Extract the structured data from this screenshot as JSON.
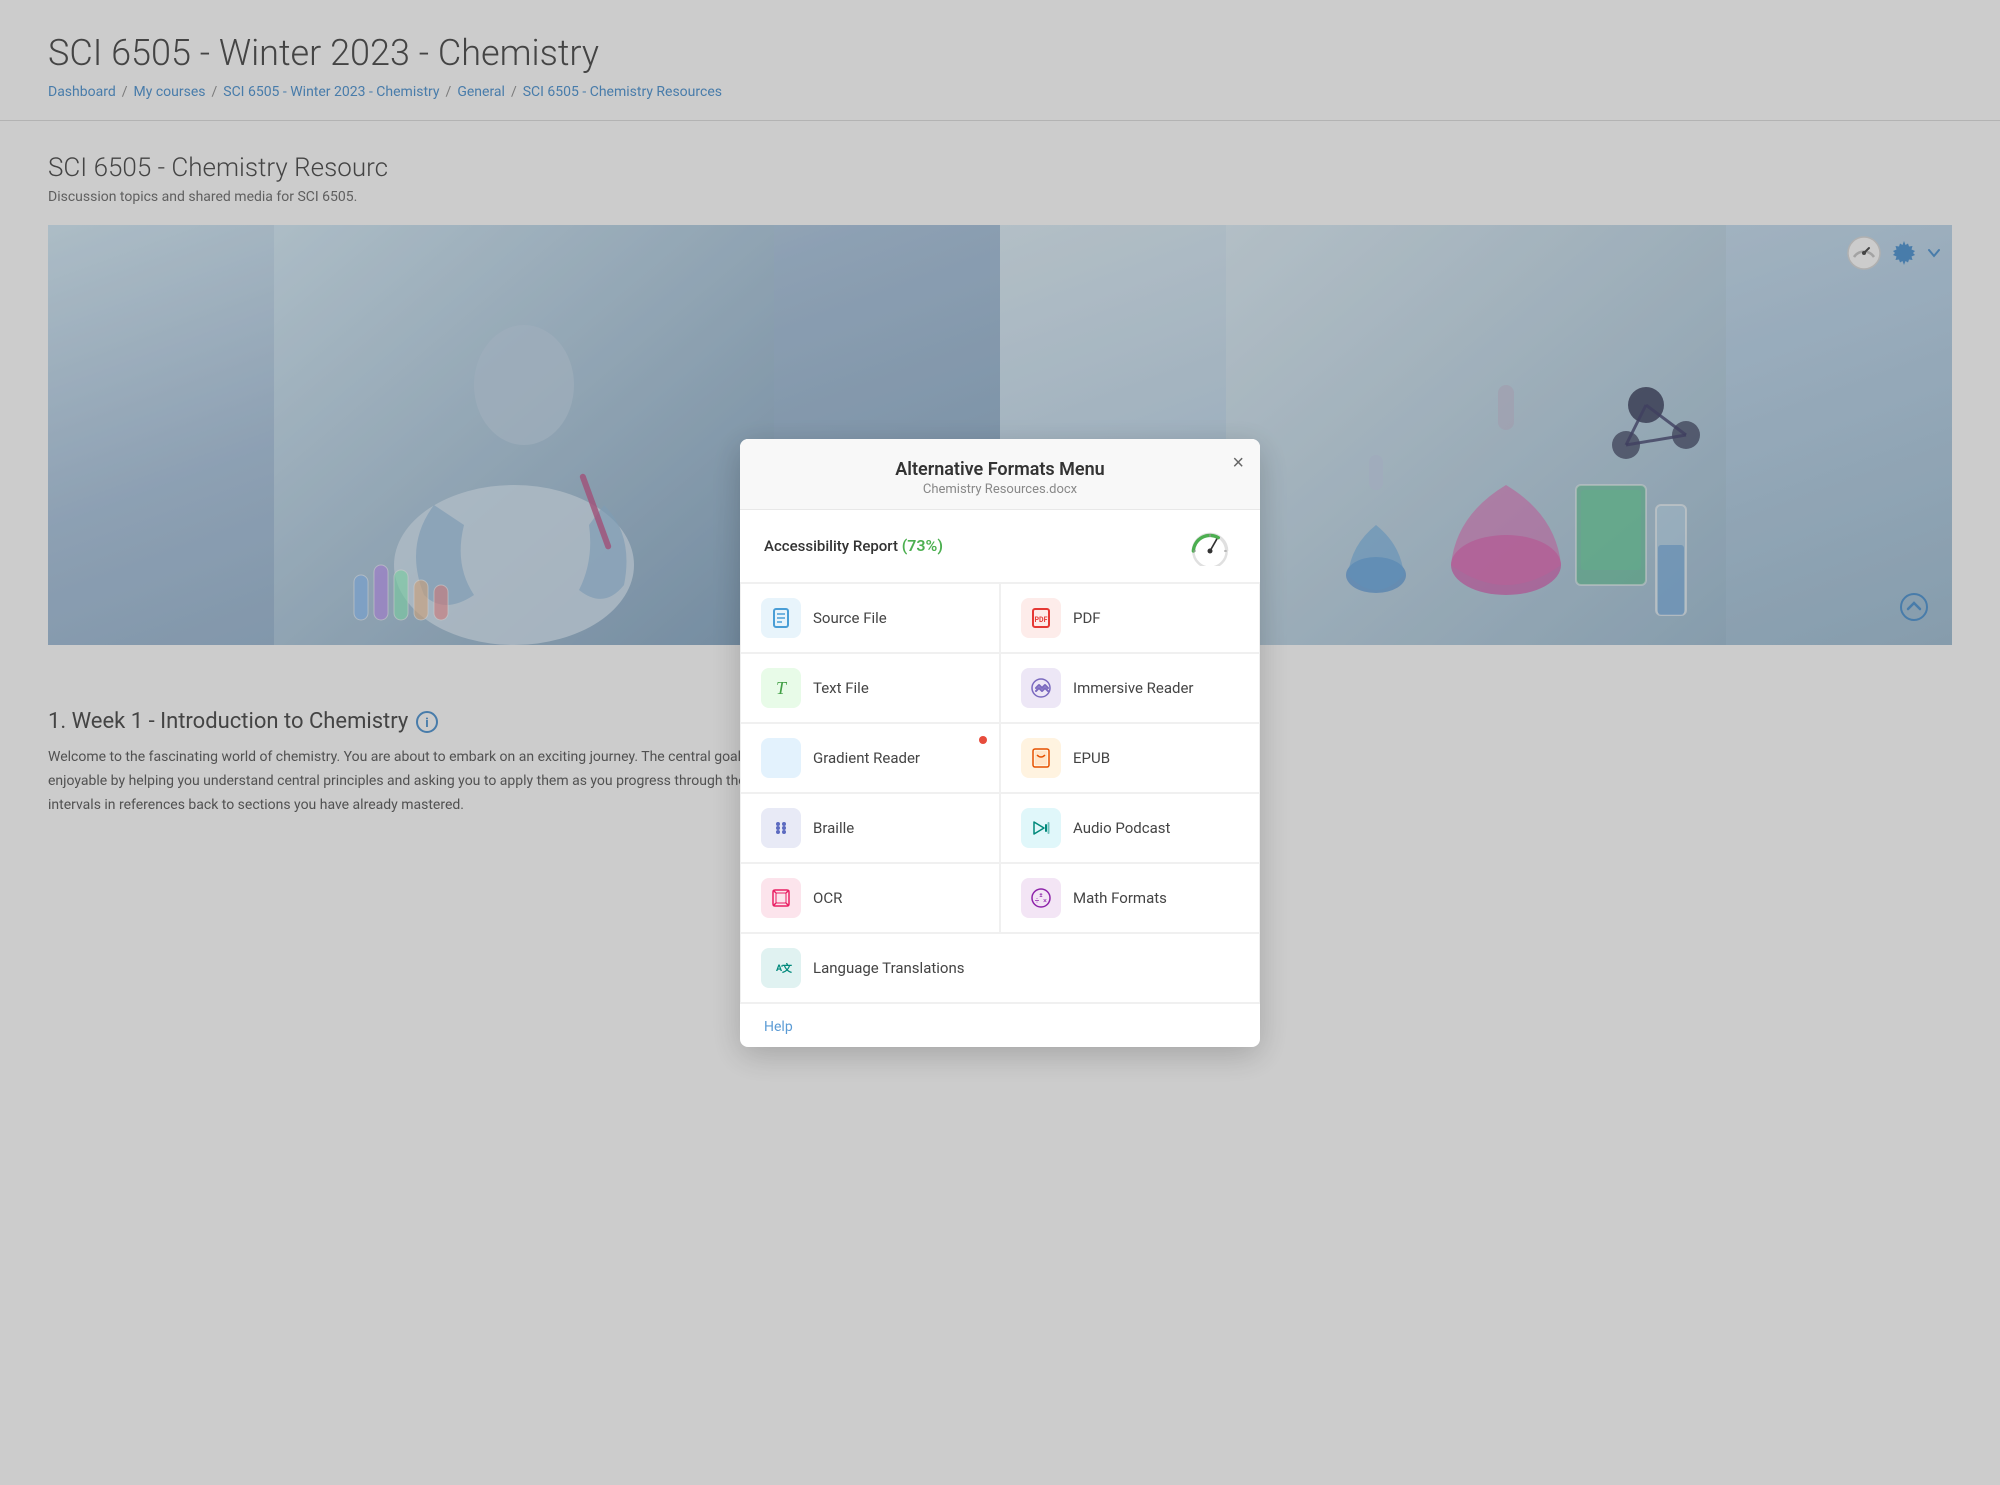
{
  "page": {
    "title": "SCI 6505 - Winter 2023 - Chemistry",
    "breadcrumbs": [
      {
        "label": "Dashboard",
        "href": "#"
      },
      {
        "label": "My courses",
        "href": "#"
      },
      {
        "label": "SCI 6505 - Winter 2023 - Chemistry",
        "href": "#"
      },
      {
        "label": "General",
        "href": "#"
      },
      {
        "label": "SCI 6505 - Chemistry Resources",
        "href": "#"
      }
    ],
    "section_title": "SCI 6505 - Chemistry Resourc",
    "section_subtitle": "Discussion topics and shared media for SCI 6505.",
    "week_title": "1. Week 1 - Introduction to Chemistry",
    "week_desc": "Welcome to the fascinating world of chemistry. You are about to embark on an exciting journey. The central goal is to make this journey through chemistry both stimulating and enjoyable by helping you understand central principles and asking you to apply them as you progress through the course. You will be reminded about these principles at frequent intervals in references back to sections you have already mastered."
  },
  "modal": {
    "title": "Alternative Formats Menu",
    "subtitle": "Chemistry Resources.docx",
    "close_label": "×",
    "accessibility_label": "Accessibility Report",
    "accessibility_pct": "(73%)",
    "help_label": "Help",
    "items": [
      {
        "id": "source-file",
        "label": "Source File",
        "icon_type": "source",
        "col": 1
      },
      {
        "id": "pdf",
        "label": "PDF",
        "icon_type": "pdf",
        "col": 2
      },
      {
        "id": "text-file",
        "label": "Text File",
        "icon_type": "text",
        "col": 1
      },
      {
        "id": "immersive-reader",
        "label": "Immersive Reader",
        "icon_type": "immersive",
        "col": 2
      },
      {
        "id": "gradient-reader",
        "label": "Gradient Reader",
        "icon_type": "gradient",
        "col": 1,
        "has_dot": true
      },
      {
        "id": "epub",
        "label": "EPUB",
        "icon_type": "epub",
        "col": 2
      },
      {
        "id": "braille",
        "label": "Braille",
        "icon_type": "braille",
        "col": 1
      },
      {
        "id": "audio-podcast",
        "label": "Audio Podcast",
        "icon_type": "audio",
        "col": 2
      },
      {
        "id": "ocr",
        "label": "OCR",
        "icon_type": "ocr",
        "col": 1
      },
      {
        "id": "math-formats",
        "label": "Math Formats",
        "icon_type": "math",
        "col": 2
      },
      {
        "id": "language-translations",
        "label": "Language Translations",
        "icon_type": "lang",
        "col": "full"
      }
    ]
  }
}
